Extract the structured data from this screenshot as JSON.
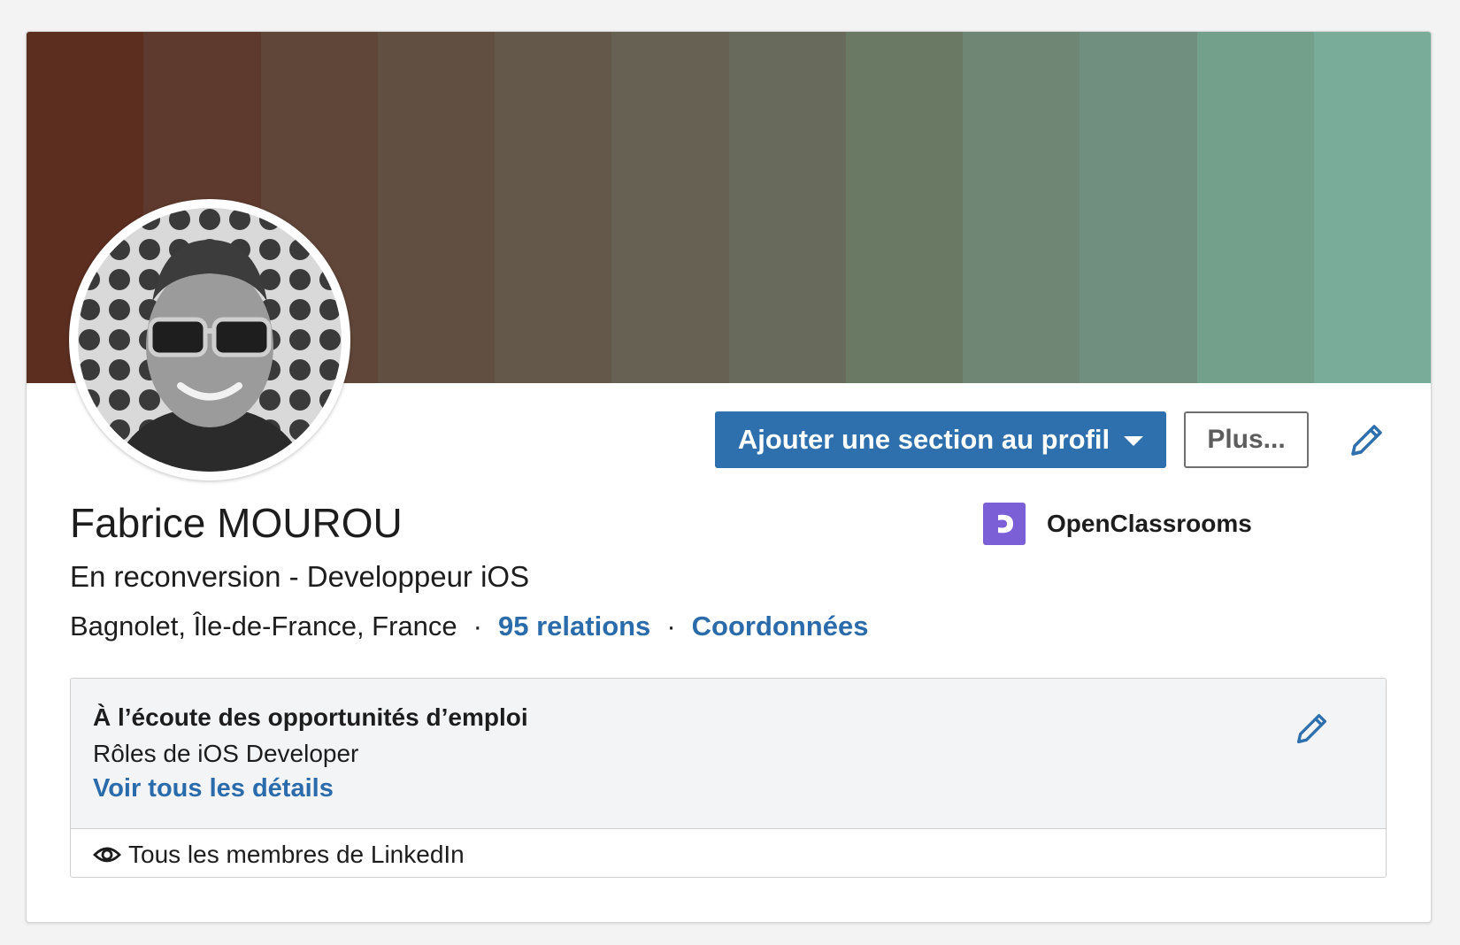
{
  "banner": {
    "colors": [
      "#5c2e20",
      "#5e3a2e",
      "#604639",
      "#615041",
      "#635849",
      "#666152",
      "#686a5c",
      "#697964",
      "#6e8673",
      "#718f7f",
      "#73a08a",
      "#79ad9a"
    ]
  },
  "profile": {
    "name": "Fabrice MOUROU",
    "headline": "En reconversion - Developpeur iOS",
    "location": "Bagnolet, Île-de-France, France",
    "separator": "·",
    "connections": "95 relations",
    "contact_info": "Coordonnées"
  },
  "actions": {
    "add_section_label": "Ajouter une section au profil",
    "more_label": "Plus..."
  },
  "company": {
    "name": "OpenClassrooms",
    "logo_color": "#7b5fd6"
  },
  "open_to_work": {
    "title": "À l’écoute des opportunités d’emploi",
    "roles": "Rôles de iOS Developer",
    "details_link": "Voir tous les détails",
    "visibility": "Tous les membres de LinkedIn"
  },
  "theme": {
    "primary_blue": "#2e6fad",
    "link_blue": "#2a6cab"
  }
}
